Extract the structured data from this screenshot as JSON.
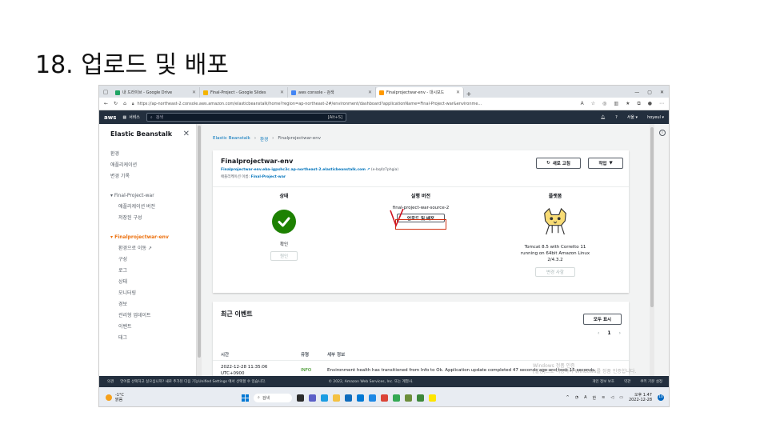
{
  "slide_title": "18. 업로드 및 배포",
  "browser": {
    "tabs": [
      {
        "label": "내 드라이브 - Google Drive",
        "color": "#1fa463"
      },
      {
        "label": "Final-Project - Google Slides",
        "color": "#f4b400"
      },
      {
        "label": "aws console - 검색",
        "color": "#4285f4"
      },
      {
        "label": "Finalprojectwar-env - 대시보드",
        "color": "#ff9900"
      }
    ],
    "url": "https://ap-northeast-2.console.aws.amazon.com/elasticbeanstalk/home?region=ap-northeast-2#/environment/dashboard?applicationName=Final-Project-war&environme..."
  },
  "aws_header": {
    "logo": "aws",
    "services": "서비스",
    "search_placeholder": "검색",
    "search_shortcut": "[Alt+S]",
    "region": "서울 ▾",
    "user": "hoyeul ▾"
  },
  "sidebar": {
    "title": "Elastic Beanstalk",
    "top_items": [
      "환경",
      "애플리케이션",
      "변경 기록"
    ],
    "app_group": "Final-Project-war",
    "app_items": [
      "애플리케이션 버전",
      "저장된 구성"
    ],
    "env_group": "Finalprojectwar-env",
    "env_items": [
      "환경으로 이동",
      "구성",
      "로그",
      "상태",
      "모니터링",
      "경보",
      "관리형 업데이트",
      "이벤트",
      "태그"
    ]
  },
  "breadcrumb": {
    "root": "Elastic Beanstalk",
    "mid": "환경",
    "current": "Finalprojectwar-env"
  },
  "environment": {
    "name": "Finalprojectwar-env",
    "url": "Finalprojectwar-env.eba-igpxhc3c.ap-northeast-2.elasticbeanstalk.com",
    "env_id": "(e-bq4z7phgia)",
    "app_label": "애플리케이션 이름:",
    "app_name": "Final-Project-war",
    "refresh_button": "새로 고침",
    "actions_button": "작업",
    "health_header": "상태",
    "health_status": "확인",
    "health_button": "원인",
    "version_header": "실행 버전",
    "version_value": "final-project-war-source-2",
    "upload_button": "업로드 및 배포",
    "platform_header": "플랫폼",
    "platform_line1": "Tomcat 8.5 with Corretto 11",
    "platform_line2": "running on 64bit Amazon Linux",
    "platform_line3": "2/4.3.2",
    "platform_button": "변경 사항"
  },
  "events": {
    "title": "최근 이벤트",
    "show_all_button": "모두 표시",
    "page": "1",
    "col_time": "시간",
    "col_type": "유형",
    "col_detail": "세부 정보",
    "row_time_1": "2022-12-28 11:35:06",
    "row_time_2": "UTC+0900",
    "row_type": "INFO",
    "row_detail": "Environment health has transitioned from Info to Ok. Application update completed 47 seconds ago and took 15 seconds.",
    "watermark_1": "Windows 정품 인증",
    "watermark_2": "[설정]으로 이동하여 Windows를 정품 인증합니다."
  },
  "footer": {
    "left": "의견",
    "notice": "언어를 선택하고 싶으십니까? 새로 추가된 다음 기능Unified Settings 에서 선택할 수 있습니다.",
    "copyright": "© 2022, Amazon Web Services, Inc. 또는 계열사.",
    "privacy": "개인 정보 보호",
    "terms": "약관",
    "cookies": "쿠키 기본 설정"
  },
  "taskbar": {
    "temperature": "-1°C",
    "weather": "맑음",
    "search": "검색",
    "lang": "한",
    "time": "오후 1:47",
    "date": "2022-12-28",
    "notifications": "10"
  }
}
